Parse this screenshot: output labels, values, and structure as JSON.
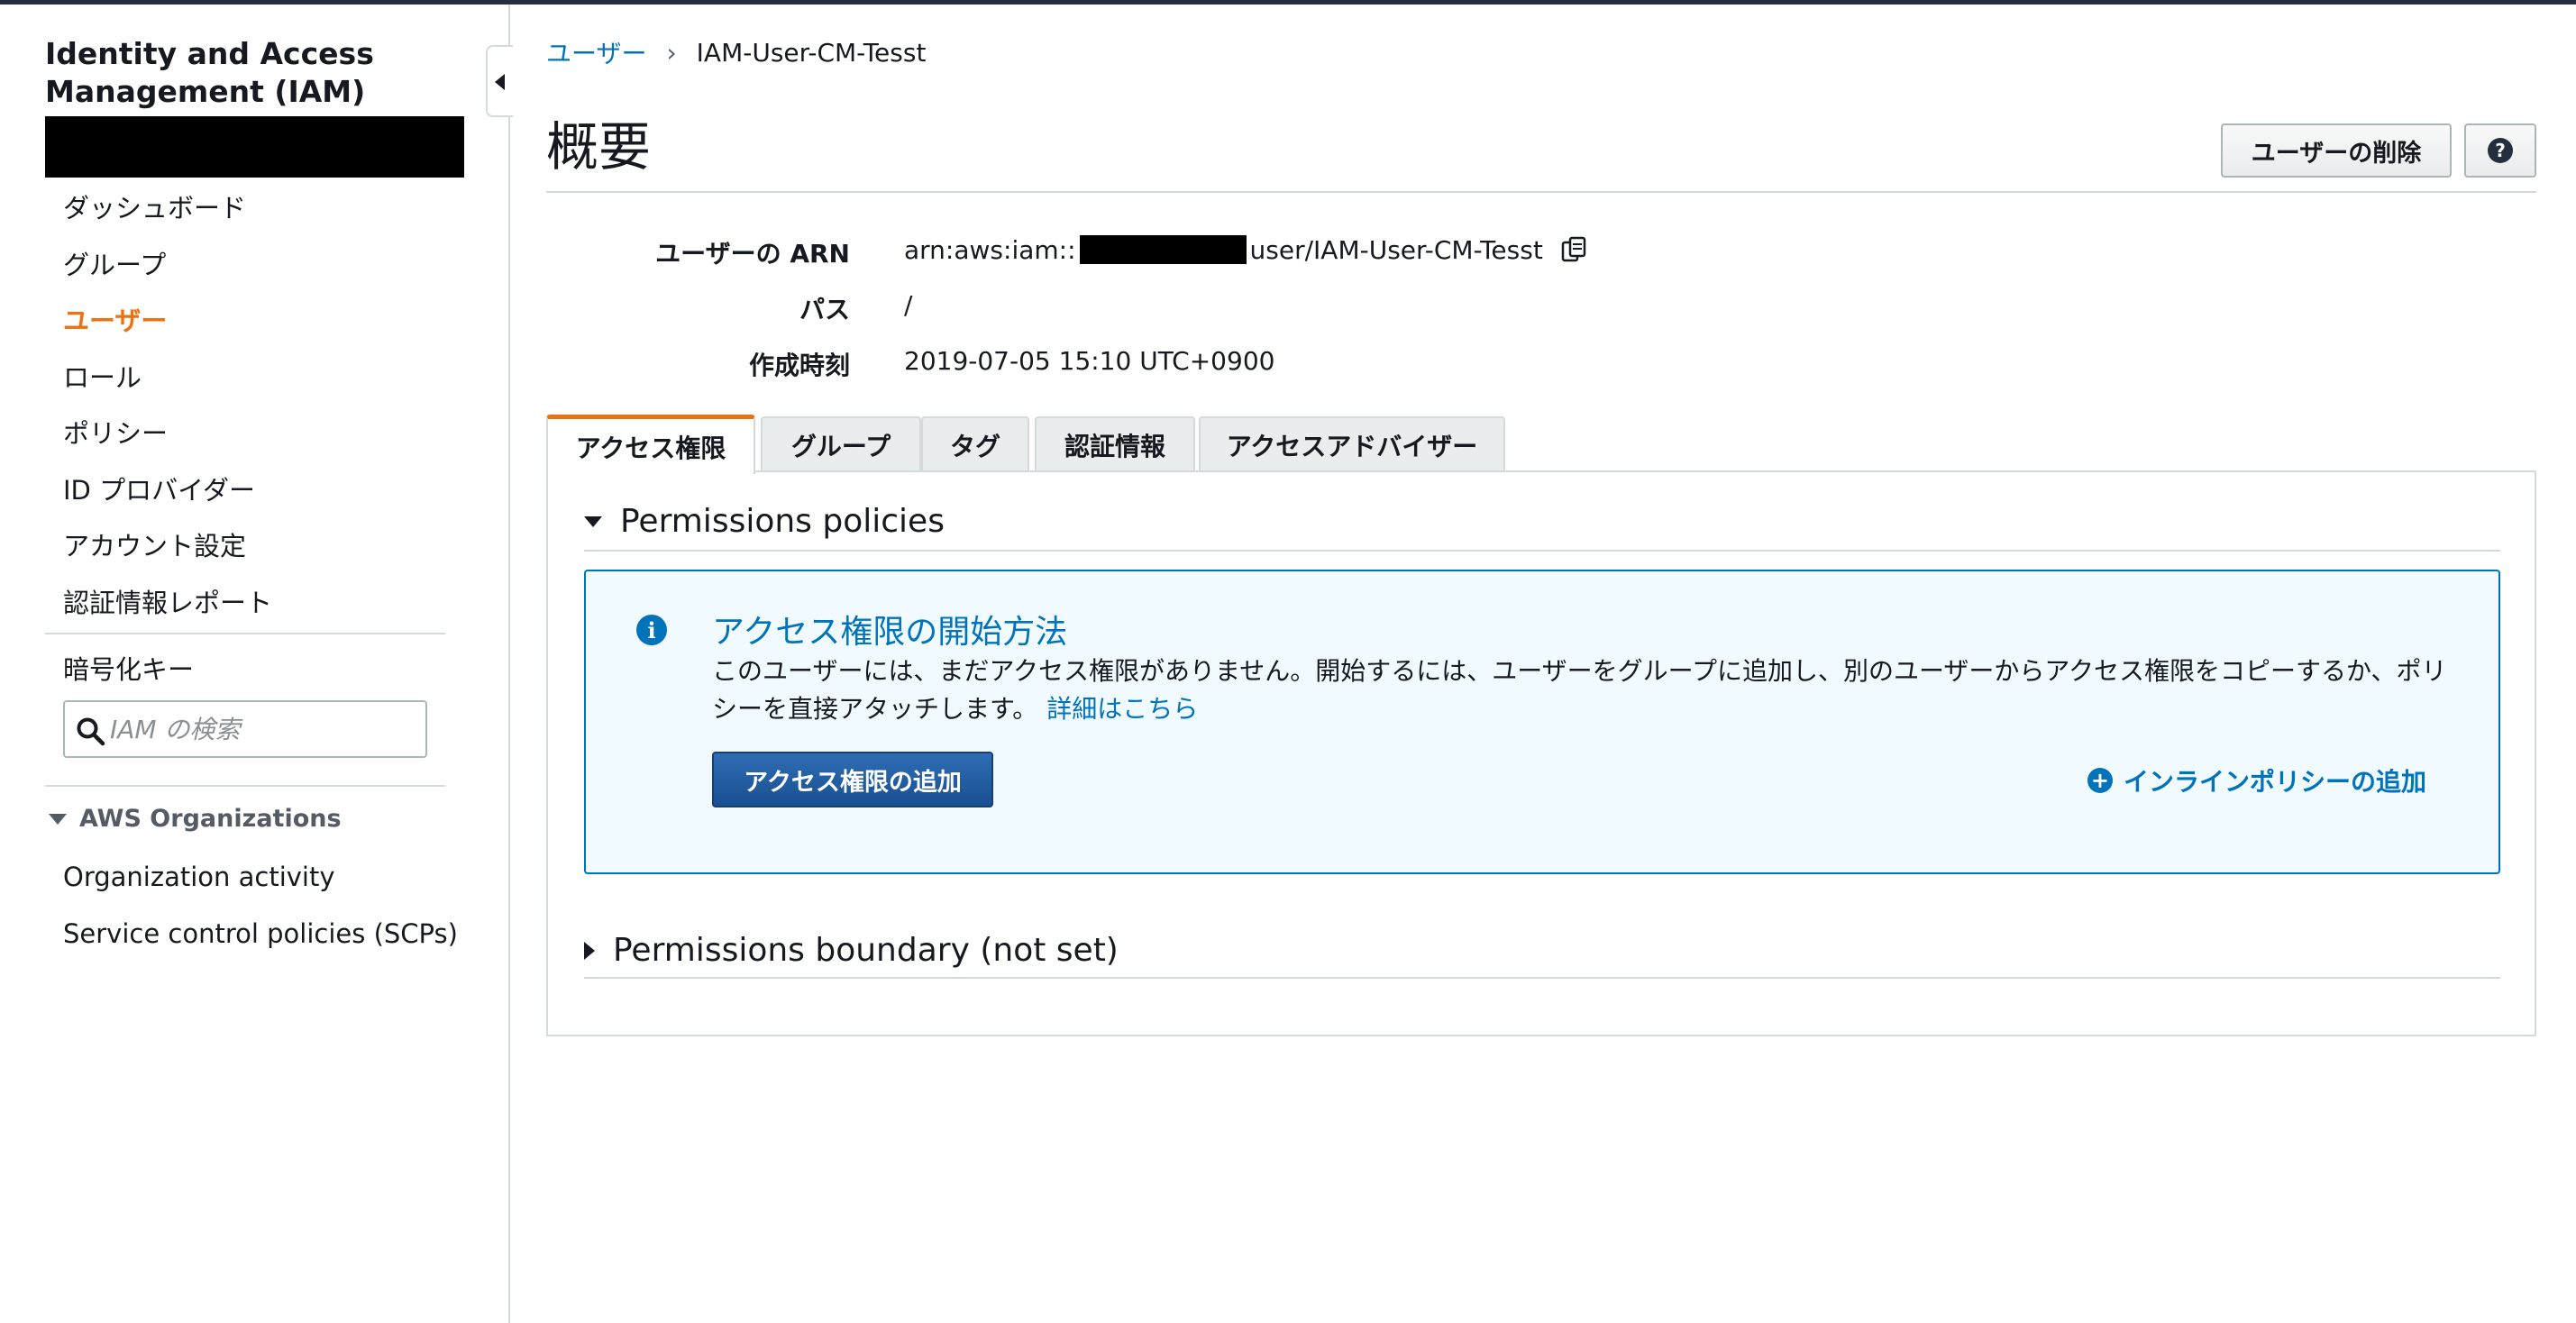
{
  "sidebar": {
    "title": "Identity and Access Management (IAM)",
    "items": [
      {
        "label": "ダッシュボード"
      },
      {
        "label": "グループ"
      },
      {
        "label": "ユーザー"
      },
      {
        "label": "ロール"
      },
      {
        "label": "ポリシー"
      },
      {
        "label": "ID プロバイダー"
      },
      {
        "label": "アカウント設定"
      },
      {
        "label": "認証情報レポート"
      }
    ],
    "active_item": "ユーザー",
    "encryption_keys": "暗号化キー",
    "search_placeholder": "IAM の検索",
    "organizations": {
      "heading": "AWS Organizations",
      "items": [
        {
          "label": "Organization activity"
        },
        {
          "label": "Service control policies (SCPs)"
        }
      ]
    }
  },
  "breadcrumb": {
    "parent": "ユーザー",
    "current": "IAM-User-CM-Tesst"
  },
  "page": {
    "title": "概要",
    "delete_button": "ユーザーの削除",
    "help_button": "?"
  },
  "summary": {
    "arn_label": "ユーザーの ARN",
    "arn_prefix": "arn:aws:iam::",
    "arn_suffix": "user/IAM-User-CM-Tesst",
    "path_label": "パス",
    "path_value": "/",
    "created_label": "作成時刻",
    "created_value": "2019-07-05 15:10 UTC+0900"
  },
  "tabs": [
    {
      "label": "アクセス権限",
      "active": true
    },
    {
      "label": "グループ",
      "active": false
    },
    {
      "label": "タグ",
      "active": false
    },
    {
      "label": "認証情報",
      "active": false
    },
    {
      "label": "アクセスアドバイザー",
      "active": false
    }
  ],
  "permissions": {
    "policies_heading": "Permissions policies",
    "info_title": "アクセス権限の開始方法",
    "info_text": "このユーザーには、まだアクセス権限がありません。開始するには、ユーザーをグループに追加し、別のユーザーからアクセス権限をコピーするか、ポリシーを直接アタッチします。",
    "info_link": "詳細はこちら",
    "add_permissions_button": "アクセス権限の追加",
    "add_inline_policy": "インラインポリシーの追加",
    "boundary_heading": "Permissions boundary (not set)"
  },
  "colors": {
    "accent": "#ec7211",
    "link": "#0073bb",
    "primary_button": "#1a4f91",
    "info_background": "#f1faff",
    "border": "#d5dbdb",
    "header_bar": "#232f3e"
  }
}
